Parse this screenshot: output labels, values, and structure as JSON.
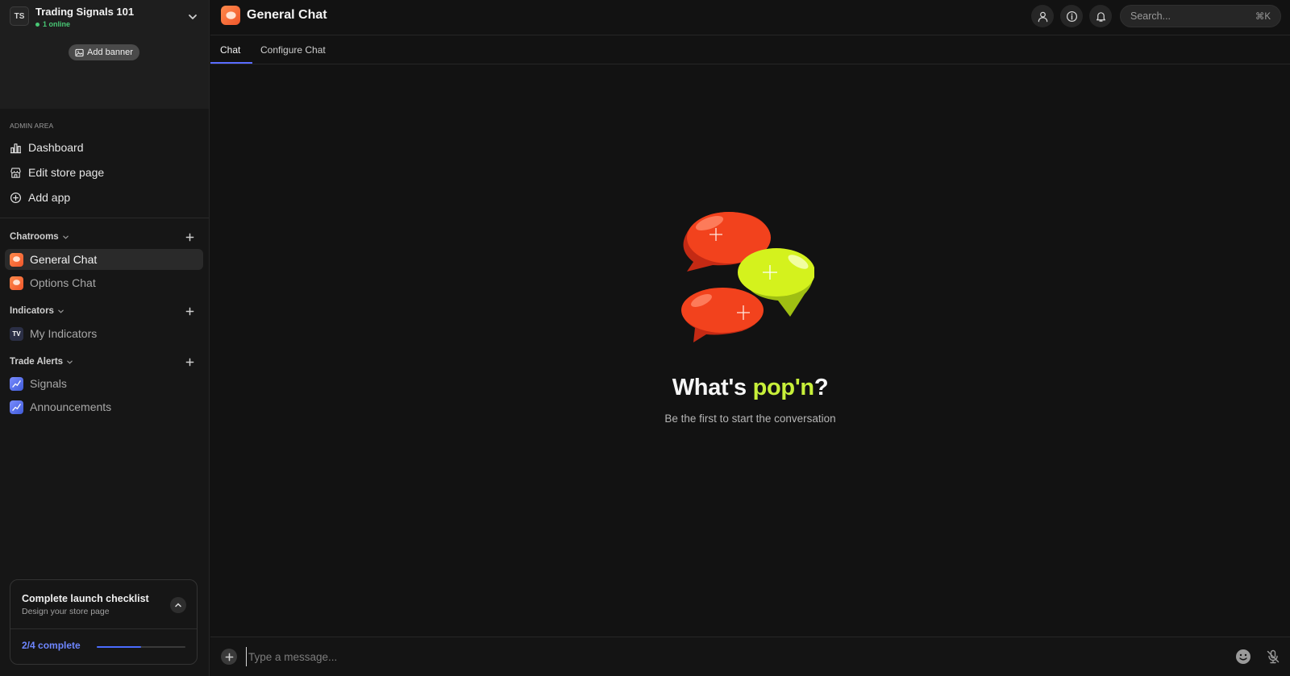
{
  "workspace": {
    "initials": "TS",
    "name": "Trading Signals 101",
    "online": "1 online",
    "add_banner": "Add banner"
  },
  "admin": {
    "label": "ADMIN AREA",
    "items": [
      {
        "label": "Dashboard",
        "icon": "bar-chart-icon"
      },
      {
        "label": "Edit store page",
        "icon": "store-icon"
      },
      {
        "label": "Add app",
        "icon": "plus-circle-icon"
      }
    ]
  },
  "sections": {
    "chatrooms": {
      "label": "Chatrooms",
      "channels": [
        "General Chat",
        "Options Chat"
      ]
    },
    "indicators": {
      "label": "Indicators",
      "channels": [
        "My Indicators"
      ],
      "icon_text": "TV"
    },
    "trade_alerts": {
      "label": "Trade Alerts",
      "channels": [
        "Signals",
        "Announcements"
      ]
    }
  },
  "checklist": {
    "title": "Complete launch checklist",
    "subtitle": "Design your store page",
    "progress_text": "2/4 complete",
    "progress_fraction": 0.5
  },
  "header": {
    "title": "General Chat",
    "search_placeholder": "Search...",
    "search_shortcut": "⌘K"
  },
  "tabs": [
    "Chat",
    "Configure Chat"
  ],
  "empty_state": {
    "title_prefix": "What's ",
    "title_highlight": "pop'n",
    "title_suffix": "?",
    "subtitle": "Be the first to start the conversation"
  },
  "composer": {
    "placeholder": "Type a message..."
  },
  "colors": {
    "accent": "#5a6cff",
    "highlight": "#c8f03a",
    "online": "#48c774",
    "chat_icon": "#f0562b"
  }
}
